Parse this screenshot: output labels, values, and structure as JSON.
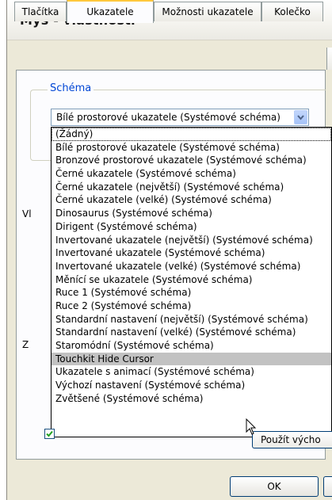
{
  "window": {
    "title": "Myš - vlastnosti"
  },
  "tabs": [
    {
      "label": "Tlačítka",
      "active": false
    },
    {
      "label": "Ukazatele",
      "active": true
    },
    {
      "label": "Možnosti ukazatele",
      "active": false
    },
    {
      "label": "Kolečko",
      "active": false
    }
  ],
  "scheme_group": {
    "label": "Schéma",
    "selected_value": "Bílé prostorové ukazatele (Systémové schéma)",
    "options": [
      "(Žádný)",
      "Bílé prostorové ukazatele (Systémové schéma)",
      "Bronzové prostorové ukazatele (Systémové schéma)",
      "Černé ukazatele  (Systémové schéma)",
      "Černé ukazatele (největší) (Systémové schéma)",
      "Černé ukazatele (velké) (Systémové schéma)",
      "Dinosaurus (Systémové schéma)",
      "Dirigent (Systémové schéma)",
      "Invertované ukazatele (největší) (Systémové schéma)",
      "Invertované ukazatele (Systémové schéma)",
      "Invertované ukazatele (velké) (Systémové schéma)",
      "Měnící se ukazatele (Systémové schéma)",
      "Ruce 1 (Systémové schéma)",
      "Ruce 2 (Systémové schéma)",
      "Standardní nastavení (největší) (Systémové schéma)",
      "Standardní nastavení (velké) (Systémové schéma)",
      "Staromódní (Systémové schéma)",
      "Touchkit Hide Cursor",
      "Ukazatele s animací (Systémové schéma)",
      "Výchozí nastavení (Systémové schéma)",
      "Zvětšené (Systémové schéma)"
    ],
    "highlighted_option": "Touchkit Hide Cursor"
  },
  "partial_labels": {
    "left_1": "Vl",
    "left_2": "",
    "left_3": "",
    "left_4": "Z"
  },
  "default_button_label": "Použít výcho",
  "ok_button_label": "OK",
  "colors": {
    "window_bg": "#ece9d8",
    "panel_bg": "#fcfcfe",
    "accent_tab": "#ffc83c",
    "group_label": "#0046d5",
    "highlight": "#c2c2c2",
    "checkmark": "#21a121"
  },
  "icons": {
    "combo_arrow": "chevron-down-icon",
    "cursor": "arrow-cursor-icon",
    "check": "check-icon"
  }
}
